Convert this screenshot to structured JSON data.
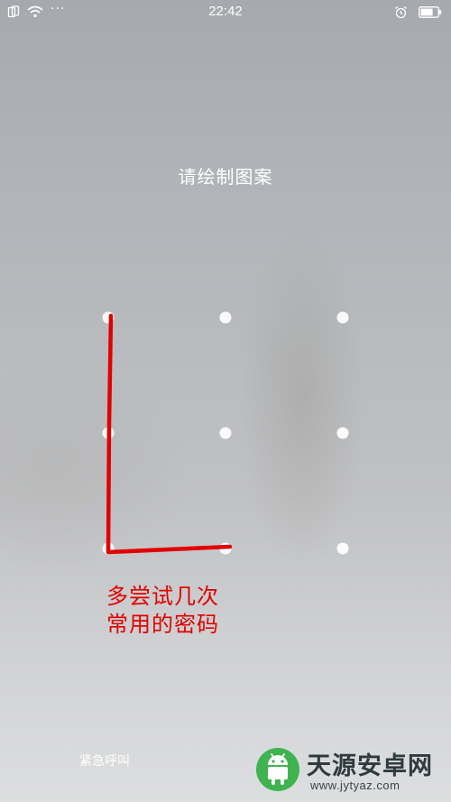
{
  "status_bar": {
    "time": "22:42",
    "more_indicator": "···",
    "icons": [
      "sim-icon",
      "wifi-icon",
      "more-dots-icon",
      "alarm-icon",
      "battery-icon"
    ]
  },
  "lock_screen": {
    "prompt": "请绘制图案",
    "emergency_call": "紧急呼叫",
    "pattern_grid": {
      "rows": 3,
      "cols": 3
    }
  },
  "annotation": {
    "color": "#e10000",
    "line1": "多尝试几次",
    "line2": "常用的密码",
    "drawn_path": "L-shape: top-left → bottom-left → bottom-middle"
  },
  "watermark": {
    "title": "天源安卓网",
    "url": "www.jytyaz.com",
    "accent_color": "#3fb34f"
  }
}
